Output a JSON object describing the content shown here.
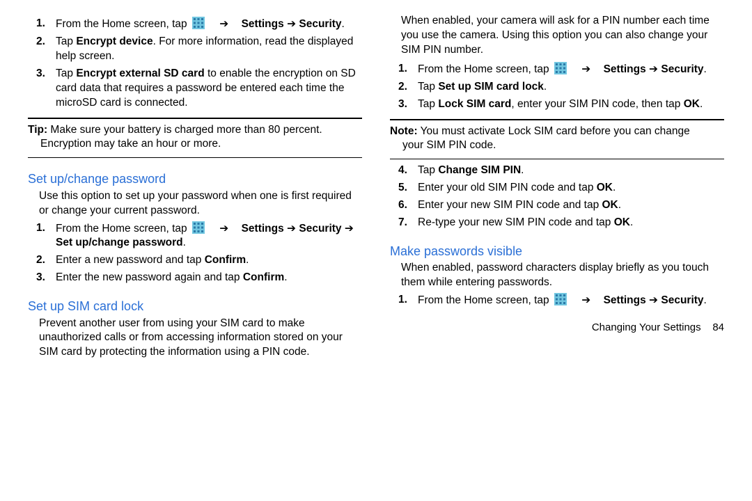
{
  "left": {
    "encrypt_steps": [
      {
        "pre": "From the Home screen, tap ",
        "icon": "apps-icon",
        "post1": "Settings",
        "post2": " ➔ ",
        "post3": "Security",
        "tail": "."
      },
      {
        "pre": "Tap ",
        "b1": "Encrypt device",
        "after": ". For more information, read the displayed help screen."
      },
      {
        "pre": "Tap ",
        "b1": "Encrypt external SD card",
        "after": " to enable the encryption on SD card data that requires a password be entered each time the microSD card is connected."
      }
    ],
    "tip_label": "Tip:",
    "tip_body_1": " Make sure your battery is charged more than 80 percent.",
    "tip_body_2": "Encryption may take an hour or more.",
    "password_heading": "Set up/change password",
    "password_intro": "Use this option to set up your password when one is first required or change your current password.",
    "password_steps": [
      {
        "pre": "From the Home screen, tap ",
        "icon": "apps-icon",
        "s1": "Settings",
        "a1": " ➔ ",
        "s2": "Security",
        "a2": " ➔ ",
        "s3": "Set up/change password",
        "tail": "."
      },
      {
        "pre": "Enter a new password and tap ",
        "b1": "Confirm",
        "tail": "."
      },
      {
        "pre": "Enter the new password again and tap ",
        "b1": "Confirm",
        "tail": "."
      }
    ],
    "sim_heading": "Set up SIM card lock",
    "sim_intro": "Prevent another user from using your SIM card to make unauthorized calls or from accessing information stored on your SIM card by protecting the information using a PIN code."
  },
  "right": {
    "sim_cont": "When enabled, your camera will ask for a PIN number each time you use the camera. Using this option you can also change your SIM PIN number.",
    "sim_steps": [
      {
        "pre": "From the Home screen, tap ",
        "icon": "apps-icon",
        "s1": "Settings",
        "a1": " ➔ ",
        "s2": "Security",
        "tail": "."
      },
      {
        "pre": "Tap ",
        "b1": "Set up SIM card lock",
        "tail": "."
      },
      {
        "pre": "Tap ",
        "b1": "Lock SIM card",
        "mid": ", enter your SIM PIN code, then tap ",
        "b2": "OK",
        "tail": "."
      }
    ],
    "note_label": "Note:",
    "note_body_1": " You must activate Lock SIM card before you can change",
    "note_body_2": "your SIM PIN code.",
    "sim_steps2": [
      {
        "pre": "Tap ",
        "b1": "Change SIM PIN",
        "tail": "."
      },
      {
        "pre": "Enter your old SIM PIN code and tap ",
        "b1": "OK",
        "tail": "."
      },
      {
        "pre": "Enter your new SIM PIN code and tap ",
        "b1": "OK",
        "tail": "."
      },
      {
        "pre": "Re-type your new SIM PIN code and tap ",
        "b1": "OK",
        "tail": "."
      }
    ],
    "visible_heading": "Make passwords visible",
    "visible_intro": "When enabled, password characters display briefly as you touch them while entering passwords.",
    "visible_steps": [
      {
        "pre": "From the Home screen, tap ",
        "icon": "apps-icon",
        "s1": "Settings",
        "a1": " ➔ ",
        "s2": "Security",
        "tail": "."
      }
    ]
  },
  "footer": {
    "label": "Changing Your Settings",
    "page": "84"
  }
}
